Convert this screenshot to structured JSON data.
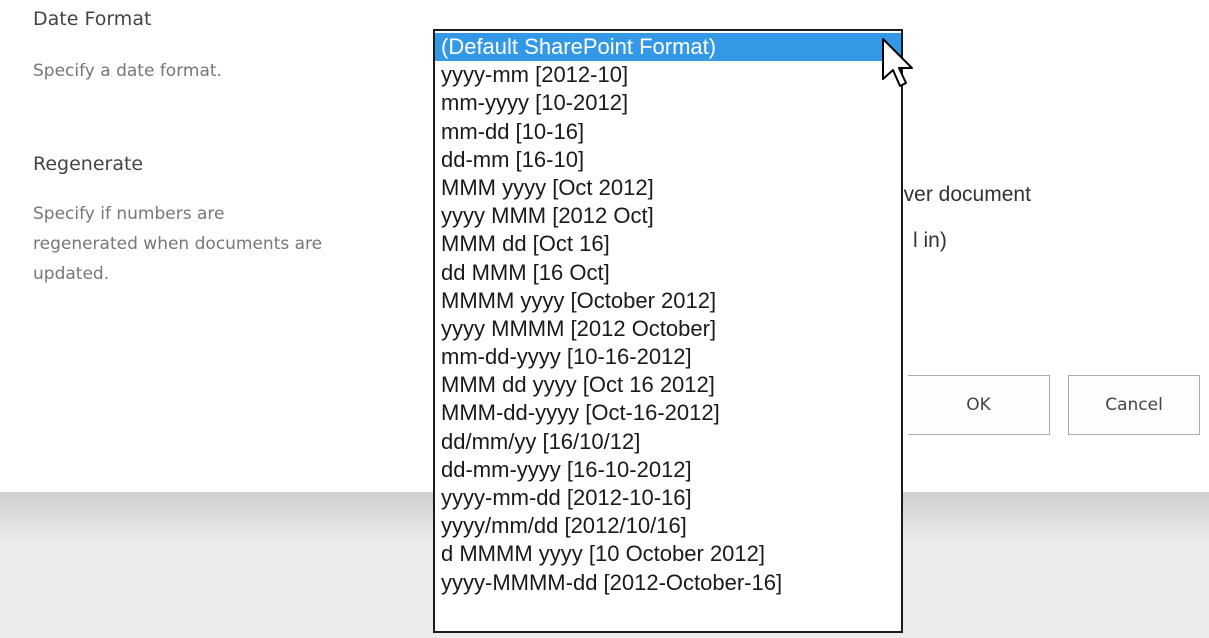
{
  "date_format": {
    "title": "Date Format",
    "description": "Specify a date format.",
    "options": [
      "(Default SharePoint Format)",
      "yyyy-mm [2012-10]",
      "mm-yyyy [10-2012]",
      "mm-dd [10-16]",
      "dd-mm [16-10]",
      "MMM yyyy [Oct 2012]",
      "yyyy MMM [2012 Oct]",
      "MMM dd [Oct 16]",
      "dd MMM [16 Oct]",
      "MMMM yyyy [October 2012]",
      "yyyy MMMM [2012 October]",
      "mm-dd-yyyy [10-16-2012]",
      "MMM dd yyyy [Oct 16 2012]",
      "MMM-dd-yyyy [Oct-16-2012]",
      "dd/mm/yy [16/10/12]",
      "dd-mm-yyyy [16-10-2012]",
      "yyyy-mm-dd [2012-10-16]",
      "yyyy/mm/dd [2012/10/16]",
      "d MMMM yyyy [10 October 2012]",
      "yyyy-MMMM-dd [2012-October-16]"
    ],
    "selected_index": 0
  },
  "regenerate": {
    "title": "Regenerate",
    "description_lines": [
      "Specify if numbers are",
      "regenerated when documents are",
      "updated."
    ],
    "partial_option_1": "ever document",
    "partial_option_2": "l in)"
  },
  "buttons": {
    "ok_label": "OK",
    "cancel_label": "Cancel"
  },
  "colors": {
    "selection": "#3399e6",
    "footer": "#ececec"
  }
}
